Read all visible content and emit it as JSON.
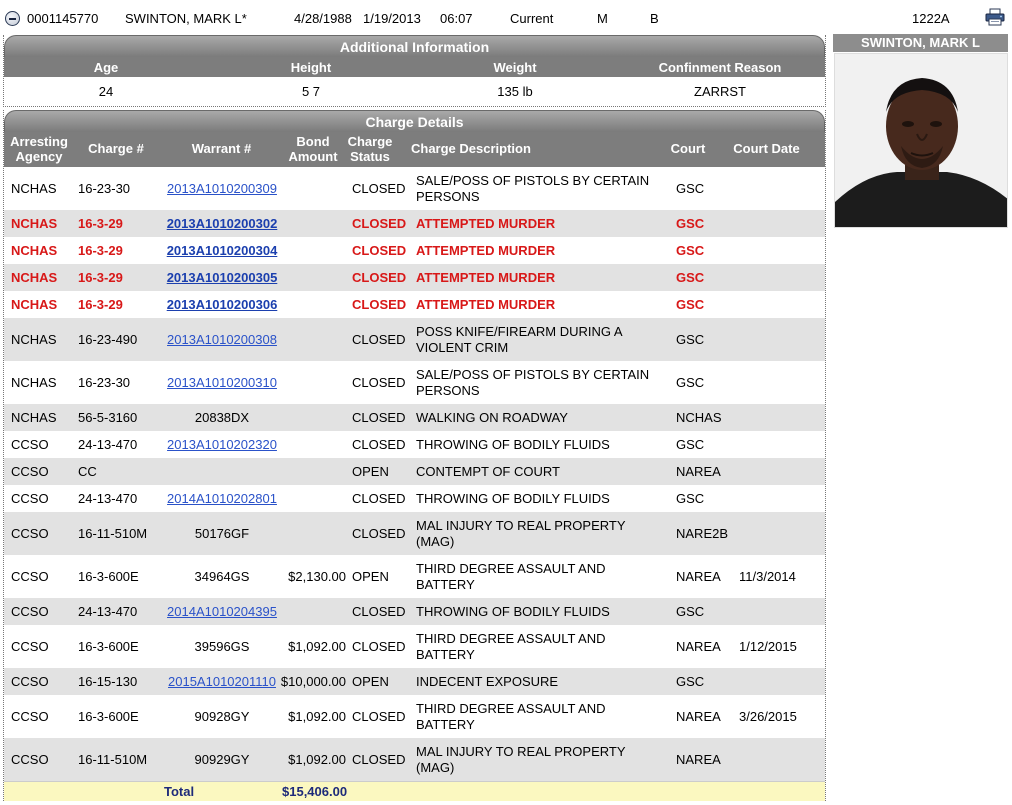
{
  "record": {
    "booking_number": "0001145770",
    "name": "SWINTON, MARK L*",
    "dob": "4/28/1988",
    "booking_date": "1/19/2013",
    "booking_time": "06:07",
    "status": "Current",
    "sex": "M",
    "race": "B",
    "cell": "1222A"
  },
  "additional_info": {
    "title": "Additional Information",
    "headers": [
      "Age",
      "Height",
      "Weight",
      "Confinment Reason"
    ],
    "values": [
      "24",
      "5 7",
      "135 lb",
      "ZARRST"
    ]
  },
  "charge_details": {
    "title": "Charge Details",
    "headers": {
      "agency": "Arresting Agency",
      "charge": "Charge #",
      "warrant": "Warrant #",
      "bond": "Bond Amount",
      "status": "Charge Status",
      "description": "Charge Description",
      "court": "Court",
      "court_date": "Court Date"
    },
    "rows": [
      {
        "agency": "NCHAS",
        "charge": "16-23-30",
        "warrant": "2013A1010200309",
        "link": true,
        "bond": "",
        "status": "CLOSED",
        "desc": "SALE/POSS OF PISTOLS BY CERTAIN PERSONS",
        "court": "GSC",
        "date": "",
        "red": false
      },
      {
        "agency": "NCHAS",
        "charge": "16-3-29",
        "warrant": "2013A1010200302",
        "link": true,
        "bond": "",
        "status": "CLOSED",
        "desc": "ATTEMPTED MURDER",
        "court": "GSC",
        "date": "",
        "red": true
      },
      {
        "agency": "NCHAS",
        "charge": "16-3-29",
        "warrant": "2013A1010200304",
        "link": true,
        "bond": "",
        "status": "CLOSED",
        "desc": "ATTEMPTED MURDER",
        "court": "GSC",
        "date": "",
        "red": true
      },
      {
        "agency": "NCHAS",
        "charge": "16-3-29",
        "warrant": "2013A1010200305",
        "link": true,
        "bond": "",
        "status": "CLOSED",
        "desc": "ATTEMPTED MURDER",
        "court": "GSC",
        "date": "",
        "red": true
      },
      {
        "agency": "NCHAS",
        "charge": "16-3-29",
        "warrant": "2013A1010200306",
        "link": true,
        "bond": "",
        "status": "CLOSED",
        "desc": "ATTEMPTED MURDER",
        "court": "GSC",
        "date": "",
        "red": true
      },
      {
        "agency": "NCHAS",
        "charge": "16-23-490",
        "warrant": "2013A1010200308",
        "link": true,
        "bond": "",
        "status": "CLOSED",
        "desc": "POSS KNIFE/FIREARM DURING A VIOLENT CRIM",
        "court": "GSC",
        "date": "",
        "red": false
      },
      {
        "agency": "NCHAS",
        "charge": "16-23-30",
        "warrant": "2013A1010200310",
        "link": true,
        "bond": "",
        "status": "CLOSED",
        "desc": "SALE/POSS OF PISTOLS BY CERTAIN PERSONS",
        "court": "GSC",
        "date": "",
        "red": false
      },
      {
        "agency": "NCHAS",
        "charge": "56-5-3160",
        "warrant": "20838DX",
        "link": false,
        "bond": "",
        "status": "CLOSED",
        "desc": "WALKING ON ROADWAY",
        "court": "NCHAS",
        "date": "",
        "red": false
      },
      {
        "agency": "CCSO",
        "charge": "24-13-470",
        "warrant": "2013A1010202320",
        "link": true,
        "bond": "",
        "status": "CLOSED",
        "desc": "THROWING OF BODILY FLUIDS",
        "court": "GSC",
        "date": "",
        "red": false
      },
      {
        "agency": "CCSO",
        "charge": "CC",
        "warrant": "",
        "link": false,
        "bond": "",
        "status": "OPEN",
        "desc": "CONTEMPT OF COURT",
        "court": "NAREA",
        "date": "",
        "red": false
      },
      {
        "agency": "CCSO",
        "charge": "24-13-470",
        "warrant": "2014A1010202801",
        "link": true,
        "bond": "",
        "status": "CLOSED",
        "desc": "THROWING OF BODILY FLUIDS",
        "court": "GSC",
        "date": "",
        "red": false
      },
      {
        "agency": "CCSO",
        "charge": "16-11-510M",
        "warrant": "50176GF",
        "link": false,
        "bond": "",
        "status": "CLOSED",
        "desc": "MAL INJURY TO REAL PROPERTY (MAG)",
        "court": "NARE2B",
        "date": "",
        "red": false
      },
      {
        "agency": "CCSO",
        "charge": "16-3-600E",
        "warrant": "34964GS",
        "link": false,
        "bond": "$2,130.00",
        "status": "OPEN",
        "desc": "THIRD DEGREE ASSAULT AND BATTERY",
        "court": "NAREA",
        "date": "11/3/2014",
        "red": false
      },
      {
        "agency": "CCSO",
        "charge": "24-13-470",
        "warrant": "2014A1010204395",
        "link": true,
        "bond": "",
        "status": "CLOSED",
        "desc": "THROWING OF BODILY FLUIDS",
        "court": "GSC",
        "date": "",
        "red": false
      },
      {
        "agency": "CCSO",
        "charge": "16-3-600E",
        "warrant": "39596GS",
        "link": false,
        "bond": "$1,092.00",
        "status": "CLOSED",
        "desc": "THIRD DEGREE ASSAULT AND BATTERY",
        "court": "NAREA",
        "date": "1/12/2015",
        "red": false
      },
      {
        "agency": "CCSO",
        "charge": "16-15-130",
        "warrant": "2015A1010201110",
        "link": true,
        "bond": "$10,000.00",
        "status": "OPEN",
        "desc": "INDECENT EXPOSURE",
        "court": "GSC",
        "date": "",
        "red": false
      },
      {
        "agency": "CCSO",
        "charge": "16-3-600E",
        "warrant": "90928GY",
        "link": false,
        "bond": "$1,092.00",
        "status": "CLOSED",
        "desc": "THIRD DEGREE ASSAULT AND BATTERY",
        "court": "NAREA",
        "date": "3/26/2015",
        "red": false
      },
      {
        "agency": "CCSO",
        "charge": "16-11-510M",
        "warrant": "90929GY",
        "link": false,
        "bond": "$1,092.00",
        "status": "CLOSED",
        "desc": "MAL INJURY TO REAL PROPERTY (MAG)",
        "court": "NAREA",
        "date": "",
        "red": false
      }
    ],
    "total_label": "Total",
    "total_amount": "$15,406.00"
  },
  "photo": {
    "name": "SWINTON, MARK L"
  },
  "colors": {
    "header_gray": "#7d7d7d",
    "alt_row": "#e2e2e2",
    "red_text": "#d81818",
    "link_blue": "#2a52c9",
    "total_bg": "#fbf8c0"
  },
  "icons": [
    "collapse-icon",
    "printer-icon"
  ]
}
